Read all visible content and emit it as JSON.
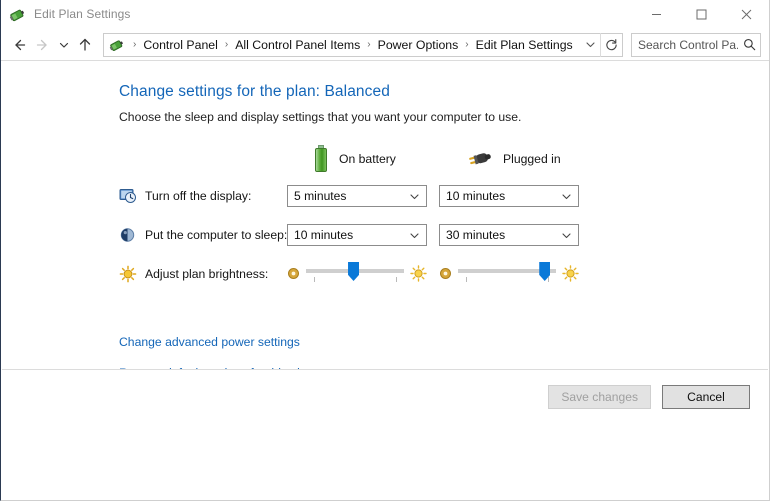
{
  "window": {
    "title": "Edit Plan Settings",
    "icon": "power-plan-icon",
    "minimize_label": "Minimize",
    "maximize_label": "Maximize",
    "close_label": "Close"
  },
  "addressbar": {
    "back_label": "Back",
    "forward_label": "Forward",
    "recent_label": "Recent locations",
    "up_label": "Up one level",
    "breadcrumbs": [
      {
        "label": "Control Panel"
      },
      {
        "label": "All Control Panel Items"
      },
      {
        "label": "Power Options"
      },
      {
        "label": "Edit Plan Settings"
      }
    ],
    "separator": "›",
    "dropdown_label": "Previous locations",
    "refresh_label": "Refresh",
    "search": {
      "placeholder": "Search Control Pa...",
      "value": "",
      "icon": "search-icon"
    }
  },
  "main": {
    "title": "Change settings for the plan: Balanced",
    "subtitle": "Choose the sleep and display settings that you want your computer to use.",
    "columns": [
      {
        "id": "battery",
        "label": "On battery",
        "icon": "battery-icon"
      },
      {
        "id": "plugged",
        "label": "Plugged in",
        "icon": "power-plug-icon"
      }
    ],
    "rows": [
      {
        "id": "turn-off-display",
        "label": "Turn off the display:",
        "icon": "display-clock-icon",
        "type": "select",
        "battery_value": "5 minutes",
        "plugged_value": "10 minutes"
      },
      {
        "id": "sleep",
        "label": "Put the computer to sleep:",
        "icon": "sleep-moon-icon",
        "type": "select",
        "battery_value": "10 minutes",
        "plugged_value": "30 minutes"
      },
      {
        "id": "brightness",
        "label": "Adjust plan brightness:",
        "icon": "brightness-sun-icon",
        "type": "slider",
        "battery_value": 48,
        "plugged_value": 88,
        "min_icon": "dim-sun-icon",
        "max_icon": "bright-sun-icon"
      }
    ],
    "links": [
      {
        "id": "advanced",
        "label": "Change advanced power settings"
      },
      {
        "id": "restore",
        "label": "Restore default settings for this plan"
      }
    ]
  },
  "footer": {
    "save_label": "Save changes",
    "save_enabled": false,
    "cancel_label": "Cancel"
  },
  "colors": {
    "link": "#1466b8",
    "heading": "#1466b8",
    "slider_thumb": "#0a79d8",
    "battery_green": "#3f9420",
    "title_text": "#8a8a8a"
  }
}
